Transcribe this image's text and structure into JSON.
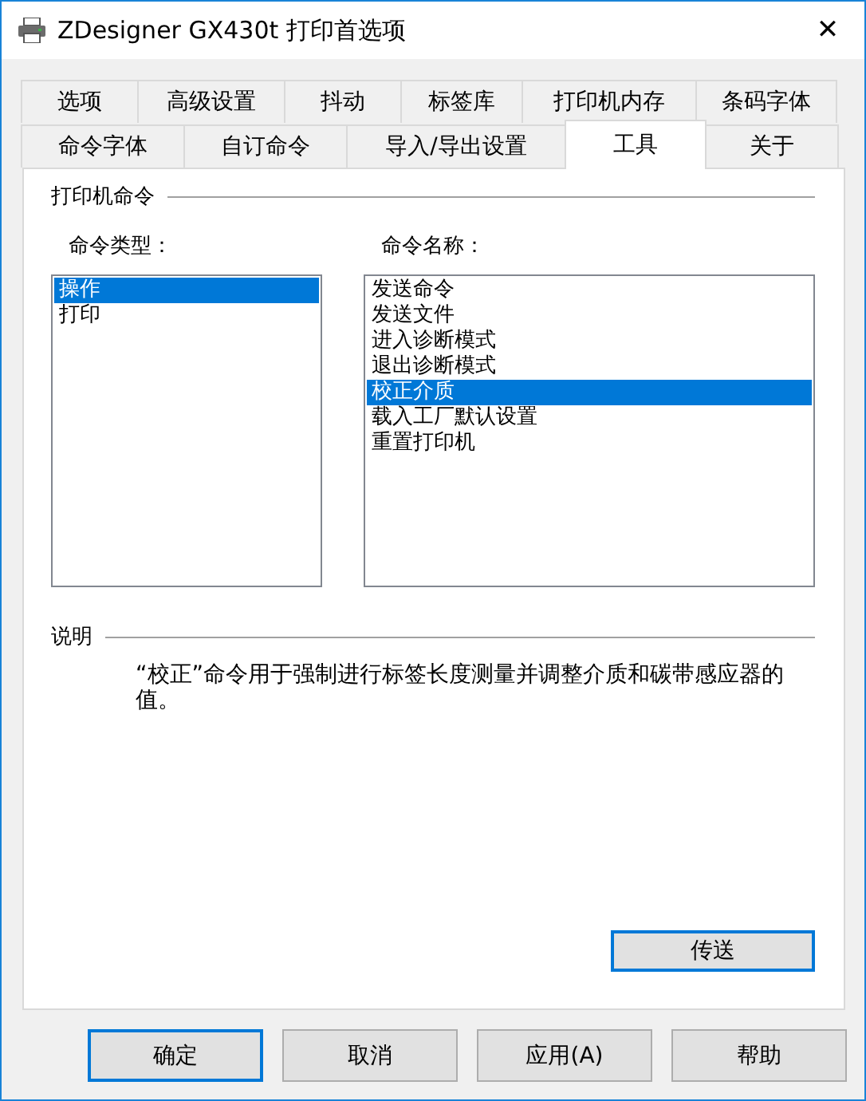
{
  "window": {
    "title": "ZDesigner GX430t 打印首选项",
    "close": "✕"
  },
  "tab_rows": [
    {
      "tabs": [
        {
          "label": "选项",
          "selected": false
        },
        {
          "label": "高级设置",
          "selected": false
        },
        {
          "label": "抖动",
          "selected": false
        },
        {
          "label": "标签库",
          "selected": false
        },
        {
          "label": "打印机内存",
          "selected": false
        },
        {
          "label": "条码字体",
          "selected": false
        }
      ]
    },
    {
      "tabs": [
        {
          "label": "命令字体",
          "selected": false
        },
        {
          "label": "自订命令",
          "selected": false
        },
        {
          "label": "导入/导出设置",
          "selected": false
        },
        {
          "label": "工具",
          "selected": true
        },
        {
          "label": "关于",
          "selected": false
        }
      ]
    }
  ],
  "printer_commands": {
    "title": "打印机命令",
    "command_type": {
      "label": "命令类型：",
      "items": [
        {
          "label": "操作",
          "selected": true
        },
        {
          "label": "打印",
          "selected": false
        }
      ]
    },
    "command_name": {
      "label": "命令名称：",
      "items": [
        {
          "label": "发送命令",
          "selected": false
        },
        {
          "label": "发送文件",
          "selected": false
        },
        {
          "label": "进入诊断模式",
          "selected": false
        },
        {
          "label": "退出诊断模式",
          "selected": false
        },
        {
          "label": "校正介质",
          "selected": true
        },
        {
          "label": "载入工厂默认设置",
          "selected": false
        },
        {
          "label": "重置打印机",
          "selected": false
        }
      ]
    }
  },
  "description": {
    "title": "说明",
    "text": "“校正”命令用于强制进行标签长度测量并调整介质和碳带感应器的值。"
  },
  "send_button": {
    "label": "传送",
    "default": true
  },
  "buttons": [
    {
      "label": "确定",
      "default": true
    },
    {
      "label": "取消",
      "default": false
    },
    {
      "label": "应用(A)",
      "default": false
    },
    {
      "label": "帮助",
      "default": false
    }
  ]
}
